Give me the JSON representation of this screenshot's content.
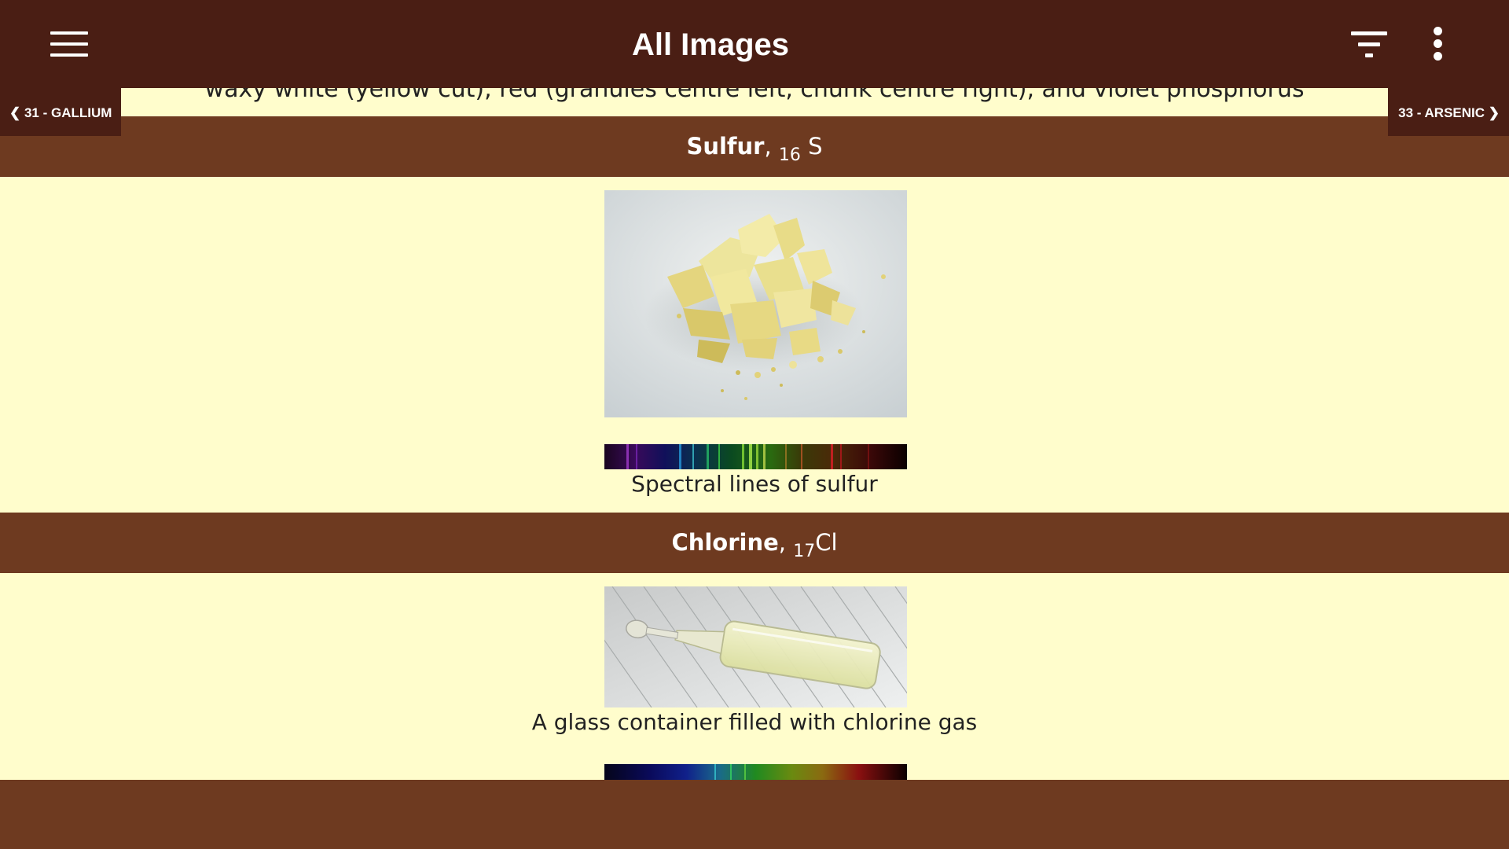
{
  "appbar": {
    "title": "All Images",
    "menu_icon": "hamburger-menu-icon",
    "filter_icon": "filter-icon",
    "more_icon": "more-vert-icon"
  },
  "nav": {
    "prev_label": "❮ 31 - GALLIUM",
    "next_label": "33 - ARSENIC ❯"
  },
  "previous_caption": "waxy white (yellow cut), red (granules centre left, chunk centre right), and violet phosphorus",
  "sections": [
    {
      "name": "Sulfur",
      "atomic_number": "16",
      "symbol": "S",
      "spectrum_caption": "Spectral lines of sulfur"
    },
    {
      "name": "Chlorine",
      "atomic_number": "17",
      "symbol": "Cl",
      "photo_caption": "A glass container filled with chlorine gas"
    }
  ],
  "colors": {
    "appbar": "#4A1E14",
    "section_header": "#6E3A20",
    "background": "#FFFDCC"
  }
}
